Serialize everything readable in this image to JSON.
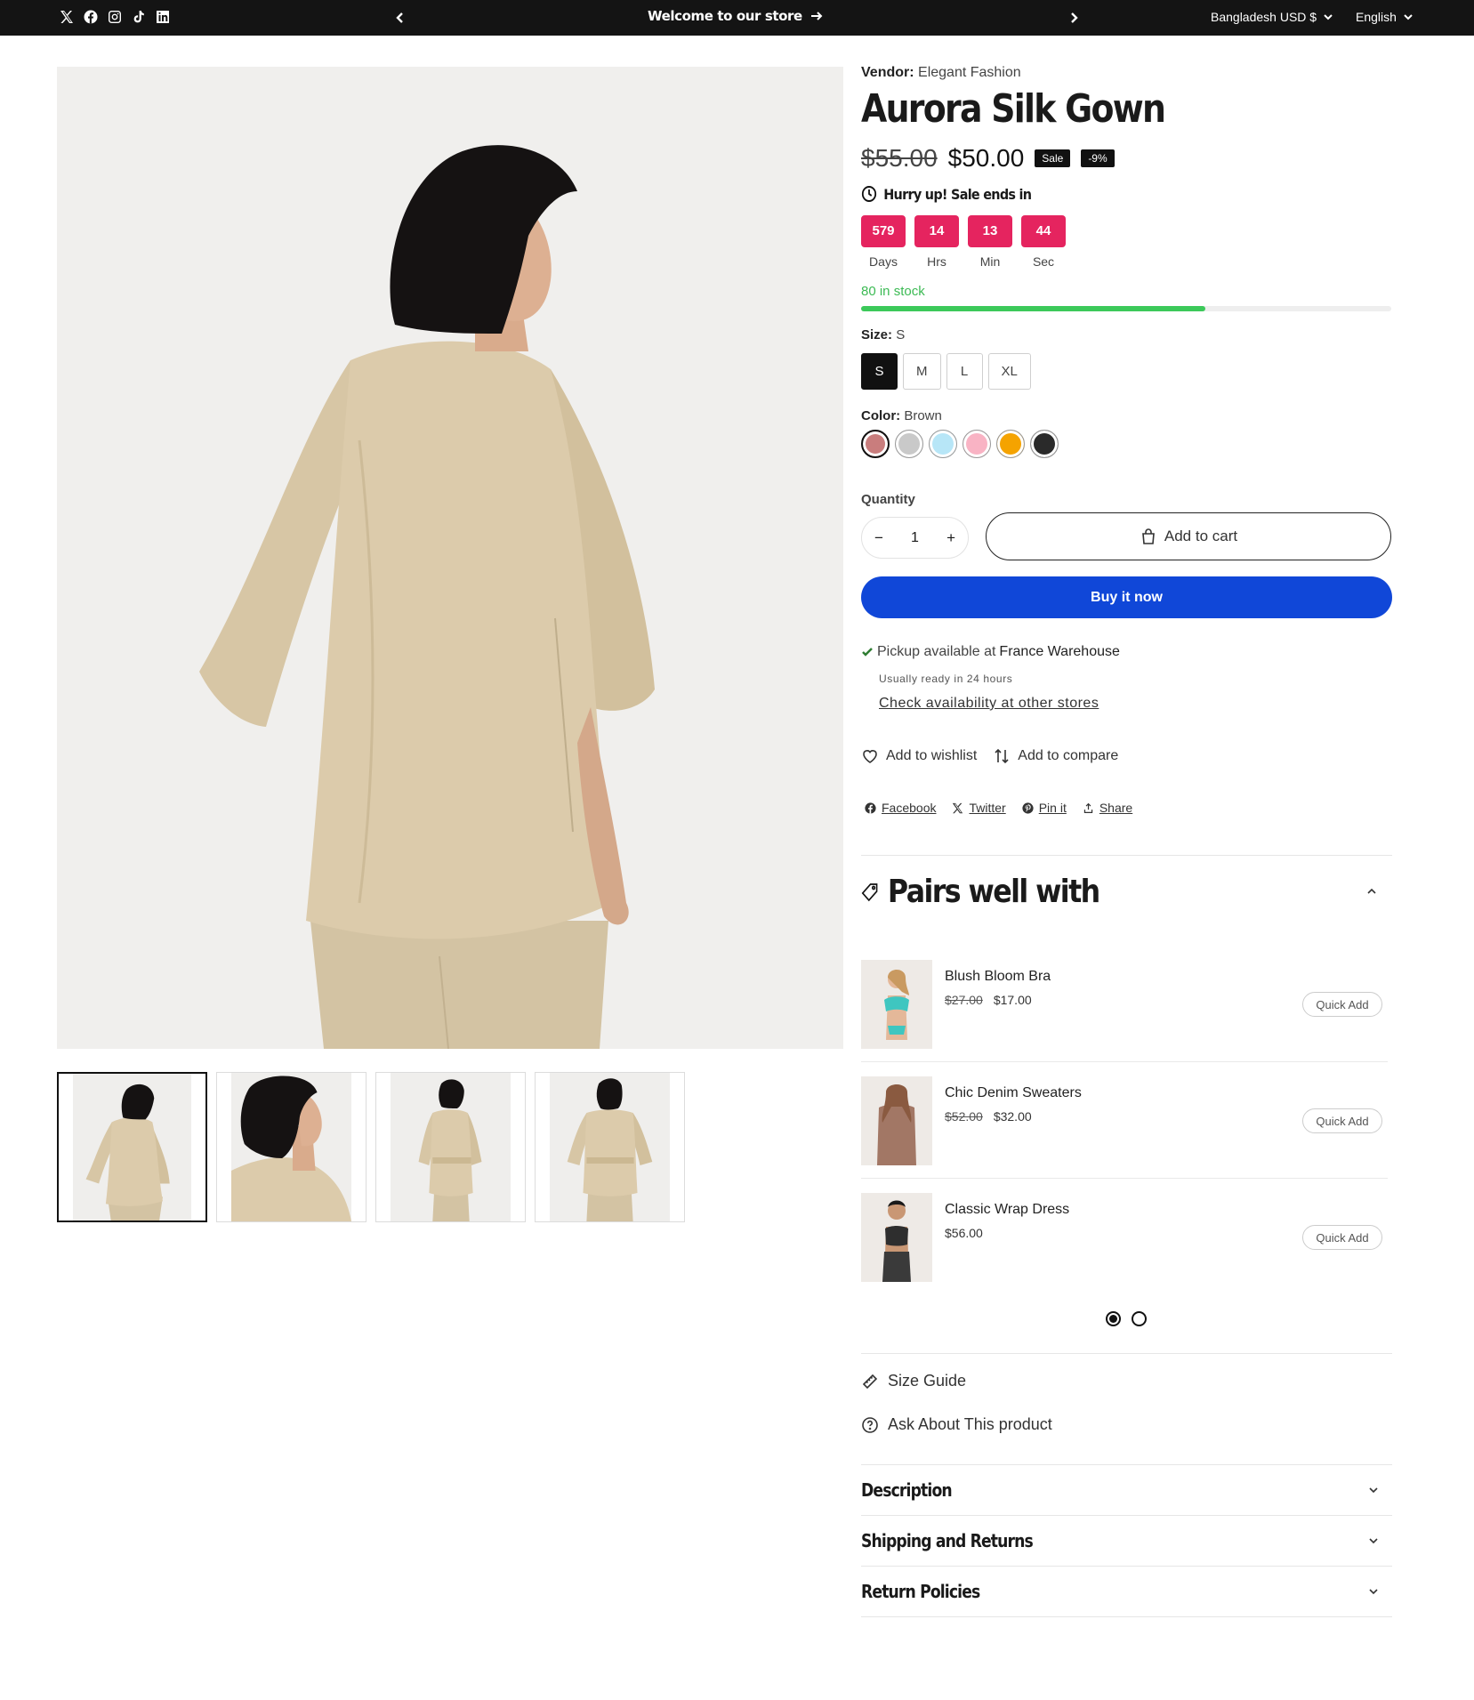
{
  "topbar": {
    "social_icons": [
      "x-icon",
      "facebook-icon",
      "instagram-icon",
      "tiktok-icon",
      "linkedin-icon"
    ],
    "announcement": "Welcome to our store",
    "country": "Bangladesh USD $",
    "language": "English"
  },
  "gallery": {
    "thumbnails": [
      "back-view",
      "side-closeup",
      "front-belted",
      "front-tied"
    ],
    "active_thumbnail": 0
  },
  "product": {
    "vendor_label": "Vendor:",
    "vendor": "Elegant Fashion",
    "title": "Aurora Silk Gown",
    "old_price": "$55.00",
    "price": "$50.00",
    "sale_badge": "Sale",
    "discount_badge": "-9%",
    "hurry_text": "Hurry up! Sale ends in",
    "countdown": [
      {
        "value": "579",
        "label": "Days"
      },
      {
        "value": "14",
        "label": "Hrs"
      },
      {
        "value": "13",
        "label": "Min"
      },
      {
        "value": "44",
        "label": "Sec"
      }
    ],
    "stock_text": "80 in stock",
    "stock_level": 0.65,
    "size_label": "Size:",
    "size_value": "S",
    "sizes": [
      "S",
      "M",
      "L",
      "XL"
    ],
    "color_label": "Color:",
    "color_value": "Brown",
    "swatches": [
      "#c97d7d",
      "#c9c9c9",
      "#b7e6f7",
      "#f9b3c4",
      "#f5a300",
      "#2a2a2a"
    ],
    "quantity_label": "Quantity",
    "quantity": "1",
    "qty_minus": "−",
    "qty_plus": "+",
    "add_to_cart": "Add to cart",
    "buy_now": "Buy it now",
    "pickup_prefix": "Pickup available at",
    "pickup_store": "France Warehouse",
    "pickup_ready": "Usually ready in 24 hours",
    "check_availability": "Check availability at other stores",
    "wishlist": "Add to wishlist",
    "compare": "Add to compare",
    "shares": [
      "Facebook",
      "Twitter",
      "Pin it",
      "Share"
    ]
  },
  "pairs": {
    "heading": "Pairs well with",
    "items": [
      {
        "name": "Blush Bloom Bra",
        "old_price": "$27.00",
        "price": "$17.00",
        "action": "Quick Add"
      },
      {
        "name": "Chic Denim Sweaters",
        "old_price": "$52.00",
        "price": "$32.00",
        "action": "Quick Add"
      },
      {
        "name": "Classic Wrap Dress",
        "old_price": "",
        "price": "$56.00",
        "action": "Quick Add"
      }
    ],
    "page_count": 2,
    "active_page": 0
  },
  "links": {
    "size_guide": "Size Guide",
    "ask": "Ask About This product"
  },
  "accordions": [
    "Description",
    "Shipping and Returns",
    "Return Policies"
  ],
  "colors": {
    "accent_blue": "#1047d8",
    "countdown_pink": "#e5245f",
    "stock_green": "#3cc95a"
  }
}
